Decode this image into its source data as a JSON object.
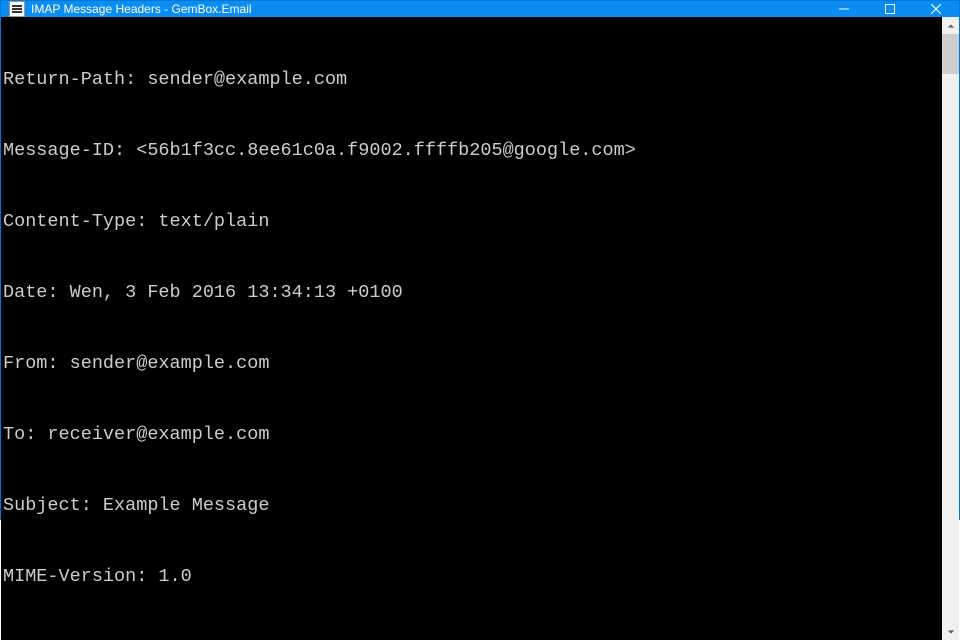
{
  "window": {
    "title": "IMAP Message Headers - GemBox.Email"
  },
  "headers": [
    "Return-Path: sender@example.com",
    "Message-ID: <56b1f3cc.8ee61c0a.f9002.ffffb205@google.com>",
    "Content-Type: text/plain",
    "Date: Wen, 3 Feb 2016 13:34:13 +0100",
    "From: sender@example.com",
    "To: receiver@example.com",
    "Subject: Example Message",
    "MIME-Version: 1.0"
  ]
}
